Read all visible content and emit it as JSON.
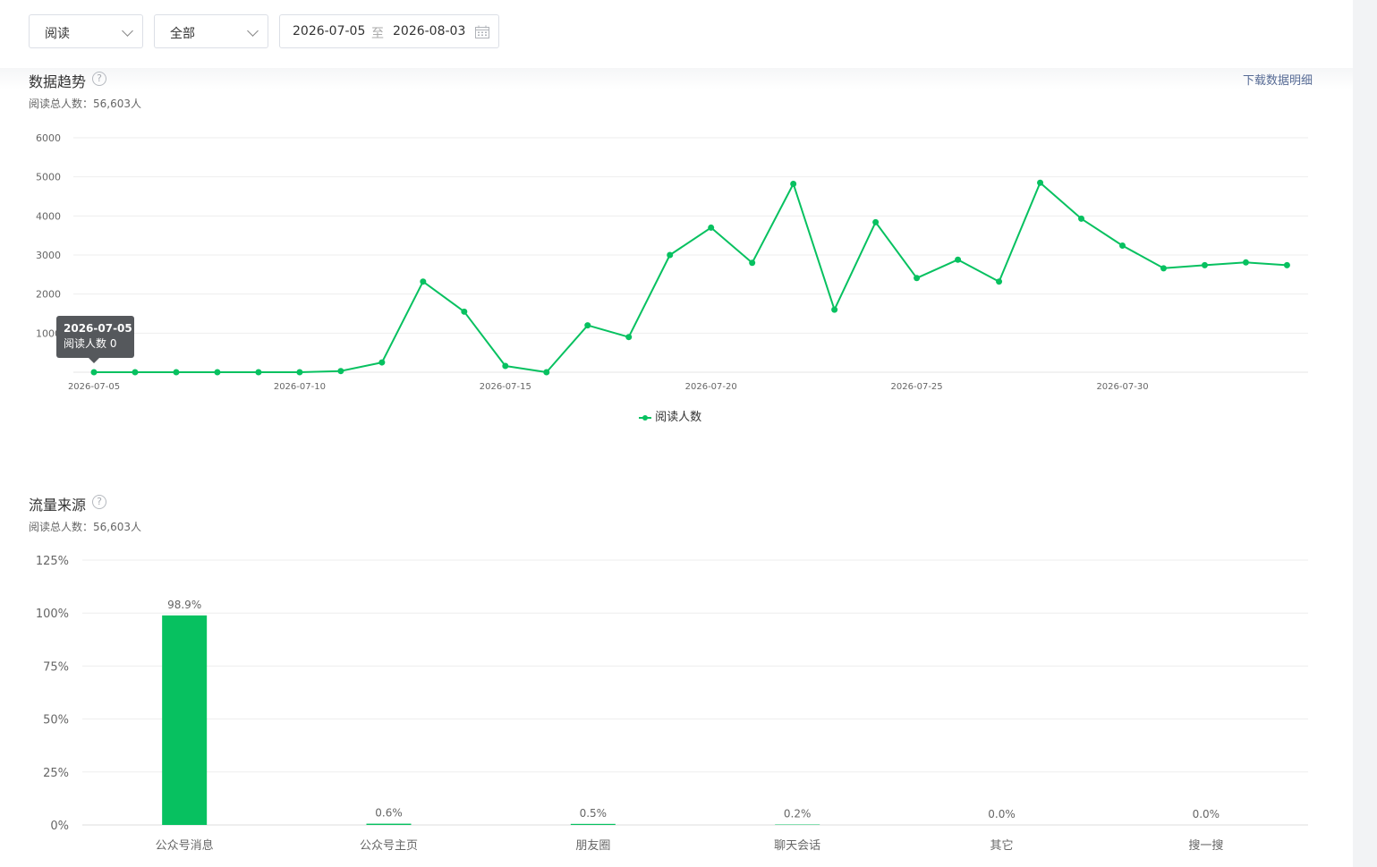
{
  "filters": {
    "metric_select": "阅读",
    "scope_select": "全部",
    "date_start": "2026-07-05",
    "date_separator": "至",
    "date_end": "2026-08-03"
  },
  "trend": {
    "title": "数据趋势",
    "help_icon": "?",
    "total_text": "阅读总人数：56,603人",
    "download_label": "下载数据明细",
    "tooltip_date": "2026-07-05",
    "tooltip_value": "阅读人数 0",
    "legend_label": "阅读人数"
  },
  "source": {
    "title": "流量来源",
    "help_icon": "?",
    "total_text": "阅读总人数：56,603人"
  },
  "colors": {
    "accent": "#07c160",
    "link": "#576b95"
  },
  "icons": {
    "calendar": "calendar-icon",
    "chevron": "chevron-down-icon",
    "help": "help-icon"
  },
  "chart_data": [
    {
      "type": "line",
      "x": [
        "2026-07-05",
        "2026-07-06",
        "2026-07-07",
        "2026-07-08",
        "2026-07-09",
        "2026-07-10",
        "2026-07-11",
        "2026-07-12",
        "2026-07-13",
        "2026-07-14",
        "2026-07-15",
        "2026-07-16",
        "2026-07-17",
        "2026-07-18",
        "2026-07-19",
        "2026-07-20",
        "2026-07-21",
        "2026-07-22",
        "2026-07-23",
        "2026-07-24",
        "2026-07-25",
        "2026-07-26",
        "2026-07-27",
        "2026-07-28",
        "2026-07-29",
        "2026-07-30",
        "2026-07-31",
        "2026-08-01",
        "2026-08-02",
        "2026-08-03"
      ],
      "xticks": [
        "2026-07-05",
        "2026-07-10",
        "2026-07-15",
        "2026-07-20",
        "2026-07-25",
        "2026-07-30"
      ],
      "series": [
        {
          "name": "阅读人数",
          "values": [
            0,
            0,
            0,
            0,
            0,
            0,
            30,
            250,
            2320,
            1550,
            160,
            0,
            1200,
            900,
            3000,
            3700,
            2800,
            4820,
            1600,
            3840,
            2410,
            2880,
            2320,
            4850,
            3930,
            3240,
            2660,
            2740,
            2810,
            2740
          ]
        }
      ],
      "yticks": [
        1000,
        2000,
        3000,
        4000,
        5000,
        6000
      ],
      "ylim": [
        0,
        6000
      ],
      "grid": true,
      "legend": "bottom-center"
    },
    {
      "type": "bar",
      "categories": [
        "公众号消息",
        "公众号主页",
        "朋友圈",
        "聊天会话",
        "其它",
        "搜一搜"
      ],
      "values": [
        98.9,
        0.6,
        0.5,
        0.2,
        0.0,
        0.0
      ],
      "value_labels": [
        "98.9%",
        "0.6%",
        "0.5%",
        "0.2%",
        "0.0%",
        "0.0%"
      ],
      "yticks": [
        "0%",
        "25%",
        "50%",
        "75%",
        "100%",
        "125%"
      ],
      "ylim": [
        0,
        125
      ],
      "grid": true
    }
  ]
}
